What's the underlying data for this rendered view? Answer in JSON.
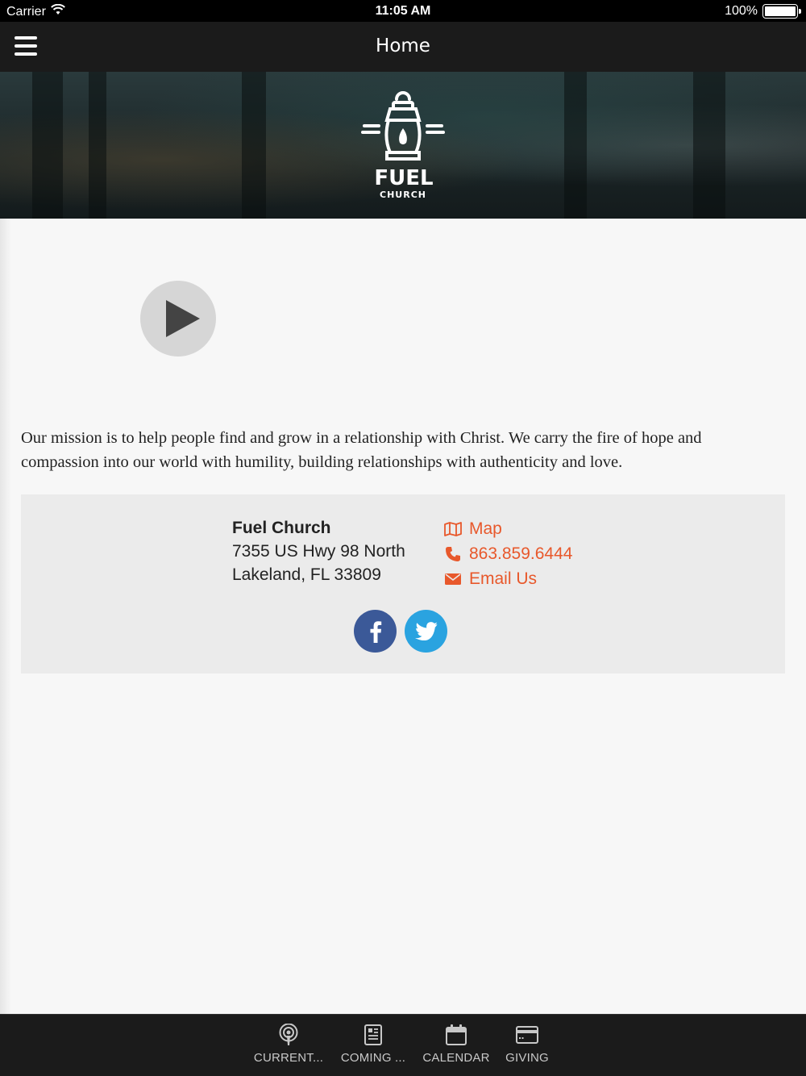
{
  "status_bar": {
    "carrier": "Carrier",
    "time": "11:05 AM",
    "battery": "100%",
    "battery_level": 1.0
  },
  "nav": {
    "title": "Home",
    "menu_icon": "hamburger-menu-icon"
  },
  "hero": {
    "logo_text_main": "FUEL",
    "logo_text_sub": "CHURCH",
    "logo_icon": "lantern-icon"
  },
  "video": {
    "play_icon": "play-icon"
  },
  "mission": {
    "text": "Our mission is to help people find and grow in a relationship with Christ. We carry the fire of hope and compassion into our world with humility, building relationships with authenticity and love."
  },
  "contact": {
    "name": "Fuel Church",
    "address_line1": "7355 US Hwy 98 North",
    "address_line2": "Lakeland, FL 33809",
    "map_label": "Map",
    "phone": "863.859.6444",
    "email_label": "Email Us",
    "link_color": "#e8582b",
    "social": [
      {
        "name": "facebook",
        "icon": "facebook-icon",
        "color": "#3b5998"
      },
      {
        "name": "twitter",
        "icon": "twitter-icon",
        "color": "#2aa3e0"
      }
    ]
  },
  "tabs": [
    {
      "label": "CURRENT...",
      "icon": "podcast-icon"
    },
    {
      "label": "COMING ...",
      "icon": "newspaper-icon"
    },
    {
      "label": "CALENDAR",
      "icon": "calendar-icon"
    },
    {
      "label": "GIVING",
      "icon": "credit-card-icon"
    }
  ]
}
